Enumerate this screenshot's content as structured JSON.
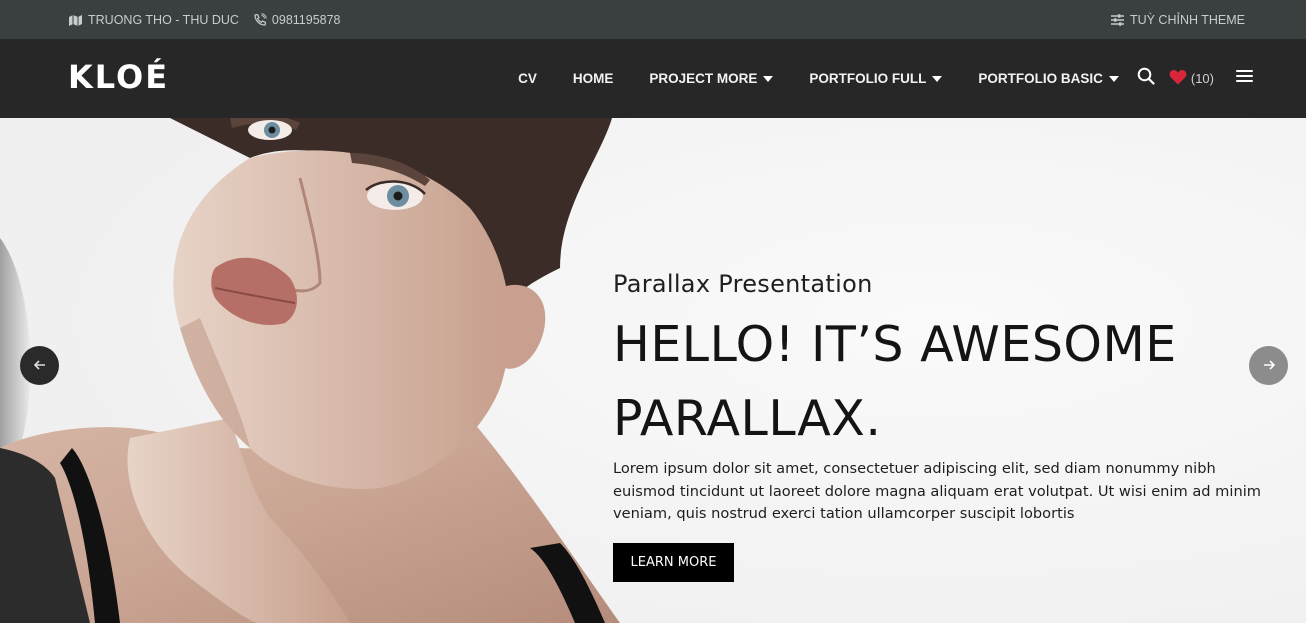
{
  "topbar": {
    "address": "TRUONG THO - THU DUC",
    "phone": "0981195878",
    "customize": "TUỲ CHỈNH THEME",
    "icons": [
      "map-icon",
      "phone-icon",
      "sliders-icon"
    ]
  },
  "header": {
    "logo": "KLOÉ",
    "nav": [
      {
        "label": "CV",
        "dropdown": false
      },
      {
        "label": "HOME",
        "dropdown": false
      },
      {
        "label": "PROJECT MORE",
        "dropdown": true
      },
      {
        "label": "PORTFOLIO FULL",
        "dropdown": true
      },
      {
        "label": "PORTFOLIO BASIC",
        "dropdown": true
      }
    ],
    "wishlist_count": "(10)",
    "icons": [
      "search-icon",
      "heart-icon",
      "menu-icon"
    ]
  },
  "hero": {
    "subtitle": "Parallax Presentation",
    "title_line1": "HELLO! IT’S AWESOME",
    "title_line2": "PARALLAX.",
    "description": "Lorem ipsum dolor sit amet, consectetuer adipiscing elit, sed diam nonummy nibh euismod tincidunt ut laoreet dolore magna aliquam erat volutpat. Ut wisi enim ad minim veniam, quis nostrud exerci tation ullamcorper suscipit lobortis",
    "button": "LEARN MORE"
  },
  "colors": {
    "topbar_bg": "#3a3f3f",
    "header_bg": "#272727",
    "heart": "#d9263a",
    "button_bg": "#000000"
  }
}
